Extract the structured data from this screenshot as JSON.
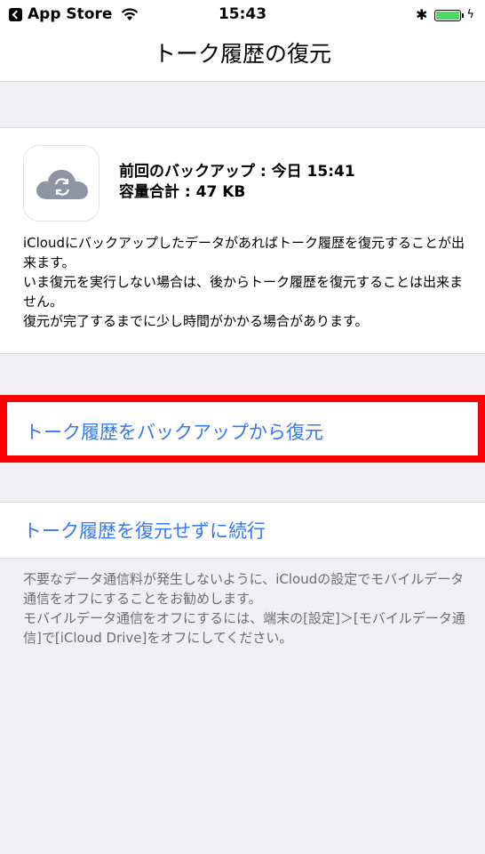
{
  "status_bar": {
    "back_app": "App Store",
    "time": "15:43",
    "battery_color": "#4cd964"
  },
  "nav": {
    "title": "トーク履歴の復元"
  },
  "backup": {
    "last_backup": "前回のバックアップ : 今日 15:41",
    "total_size": "容量合計 : 47 KB",
    "icon": "icloud-sync-icon"
  },
  "description": {
    "line1": "iCloudにバックアップしたデータがあればトーク履歴を復元することが出来ます。",
    "line2": "いま復元を実行しない場合は、後からトーク履歴を復元することは出来ません。",
    "line3": "復元が完了するまでに少し時間がかかる場合があります。"
  },
  "actions": {
    "restore_label": "トーク履歴をバックアップから復元",
    "continue_label": "トーク履歴を復元せずに続行",
    "link_color": "#3478f6",
    "highlight_color": "#ff0000"
  },
  "footer": {
    "line1": "不要なデータ通信料が発生しないように、iCloudの設定でモバイルデータ通信をオフにすることをお勧めします。",
    "line2": "モバイルデータ通信をオフにするには、端末の[設定]＞[モバイルデータ通信]で[iCloud Drive]をオフにしてください。"
  }
}
